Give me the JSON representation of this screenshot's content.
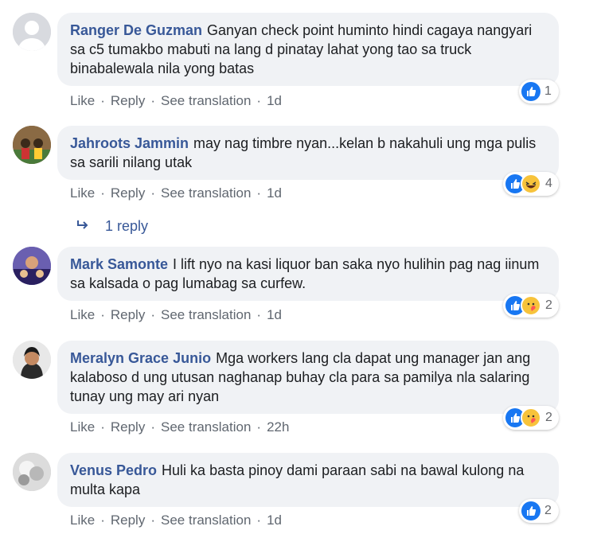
{
  "comments": [
    {
      "author": "Ranger De Guzman",
      "text": "Ganyan check point huminto hindi cagaya nangyari sa c5 tumakbo mabuti na lang d pinatay lahat yong tao sa truck binabalewala nila yong batas",
      "reaction_count": "1",
      "reactions": [
        "like-icon"
      ],
      "like": "Like",
      "reply": "Reply",
      "translate": "See translation",
      "time": "1d"
    },
    {
      "author": "Jahroots Jammin",
      "text": "may nag timbre nyan...kelan b nakahuli ung mga pulis sa sarili nilang utak",
      "reaction_count": "4",
      "reactions": [
        "like-icon",
        "haha-icon"
      ],
      "like": "Like",
      "reply": "Reply",
      "translate": "See translation",
      "time": "1d"
    },
    {
      "author": "Mark Samonte",
      "text": "I lift nyo na kasi liquor ban saka nyo hulihin pag nag iinum sa kalsada o pag lumabag sa curfew.",
      "reaction_count": "2",
      "reactions": [
        "like-icon",
        "care-icon"
      ],
      "like": "Like",
      "reply": "Reply",
      "translate": "See translation",
      "time": "1d"
    },
    {
      "author": "Meralyn Grace Junio",
      "text": "Mga workers lang cla dapat ung manager jan ang kalaboso d ung utusan naghanap buhay cla para sa pamilya nla salaring tunay ung may ari nyan",
      "reaction_count": "2",
      "reactions": [
        "like-icon",
        "care-icon"
      ],
      "like": "Like",
      "reply": "Reply",
      "translate": "See translation",
      "time": "22h"
    },
    {
      "author": "Venus Pedro",
      "text": "Huli ka basta pinoy dami paraan sabi na bawal kulong na multa kapa",
      "reaction_count": "2",
      "reactions": [
        "like-icon"
      ],
      "like": "Like",
      "reply": "Reply",
      "translate": "See translation",
      "time": "1d"
    }
  ],
  "reply_toggle": "1 reply",
  "colors": {
    "author": "#385898",
    "bubble": "#f0f2f5",
    "like_blue": "#1877f2",
    "meta": "#606770"
  }
}
